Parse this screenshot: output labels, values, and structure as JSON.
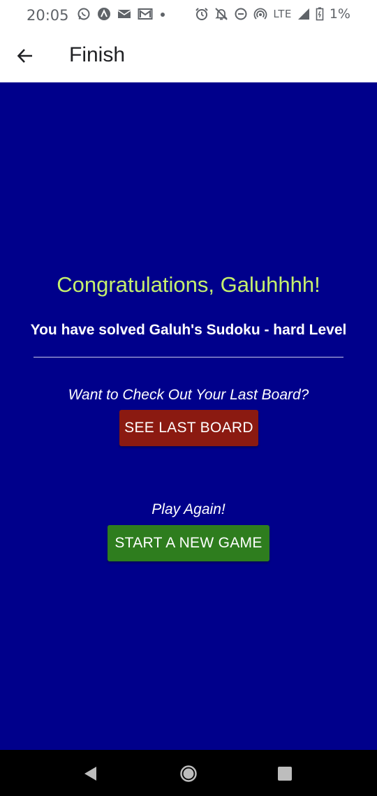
{
  "status_bar": {
    "time": "20:05",
    "network": "LTE",
    "battery": "1%",
    "left_icons": [
      "whatsapp-icon",
      "app-notification-icon",
      "email-icon",
      "gmail-icon",
      "dot-icon"
    ],
    "right_icons": [
      "alarm-icon",
      "notifications-off-icon",
      "do-not-disturb-icon",
      "hotspot-icon",
      "signal-icon",
      "battery-icon"
    ]
  },
  "app_bar": {
    "title": "Finish",
    "back_icon": "arrow-back-icon"
  },
  "main": {
    "congrats": "Congratulations, Galuhhhh!",
    "solved_message": "You have solved Galuh's Sudoku - hard Level",
    "check_prompt": "Want to Check Out Your Last Board?",
    "see_last_board_label": "SEE LAST BOARD",
    "play_prompt": "Play Again!",
    "start_new_game_label": "START A NEW GAME"
  },
  "colors": {
    "background": "#00008b",
    "congrats_text": "#c5f06d",
    "see_last_board_button": "#8b1a11",
    "start_new_game_button": "#2e7d1e"
  },
  "nav_bar": {
    "buttons": [
      "back-triangle-icon",
      "home-circle-icon",
      "recents-square-icon"
    ]
  }
}
